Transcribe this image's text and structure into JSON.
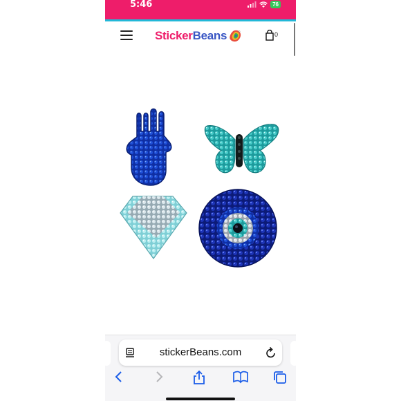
{
  "status_bar": {
    "time": "5:46",
    "battery": "76",
    "background": "#ee1d6a"
  },
  "header": {
    "logo_part1": "Sticker",
    "logo_part2": "Beans",
    "cart_count": "0"
  },
  "product": {
    "items": [
      "hamsa",
      "butterfly",
      "diamond",
      "evil-eye"
    ]
  },
  "browser": {
    "url": "stickerBeans.com"
  },
  "icons": [
    "menu-icon",
    "cart-icon",
    "reader-icon",
    "reload-icon",
    "back-icon",
    "forward-icon",
    "share-icon",
    "bookmarks-icon",
    "tabs-icon"
  ]
}
